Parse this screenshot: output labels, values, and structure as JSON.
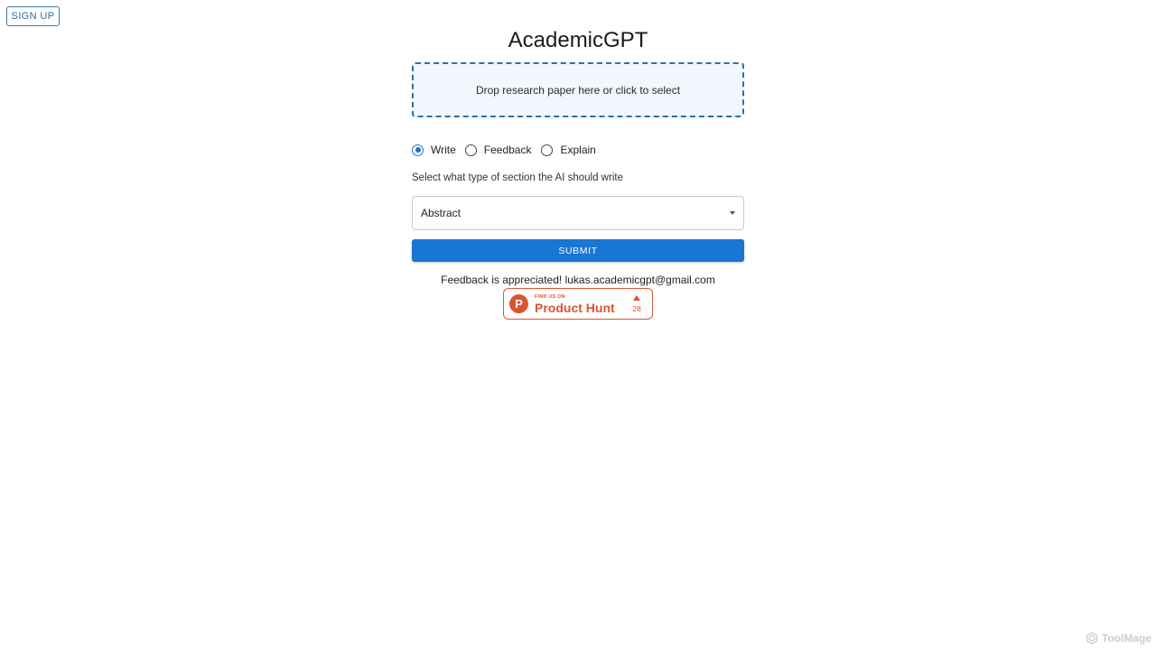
{
  "header": {
    "signup_label": "SIGN UP",
    "title": "AcademicGPT"
  },
  "upload": {
    "prompt": "Drop research paper here or click to select"
  },
  "mode": {
    "options": [
      {
        "label": "Write",
        "selected": true
      },
      {
        "label": "Feedback",
        "selected": false
      },
      {
        "label": "Explain",
        "selected": false
      }
    ]
  },
  "section_select": {
    "helper": "Select what type of section the AI should write",
    "value": "Abstract"
  },
  "submit_label": "SUBMIT",
  "footer": {
    "feedback_text": "Feedback is appreciated! lukas.academicgpt@gmail.com"
  },
  "product_hunt": {
    "small_text": "FIND US ON",
    "name": "Product Hunt",
    "logo_letter": "P",
    "upvotes": "28"
  },
  "watermark": {
    "text": "ToolMage"
  },
  "colors": {
    "primary": "#1976d2",
    "product_hunt": "#da5630",
    "dropzone_border": "#2d6fa5"
  }
}
